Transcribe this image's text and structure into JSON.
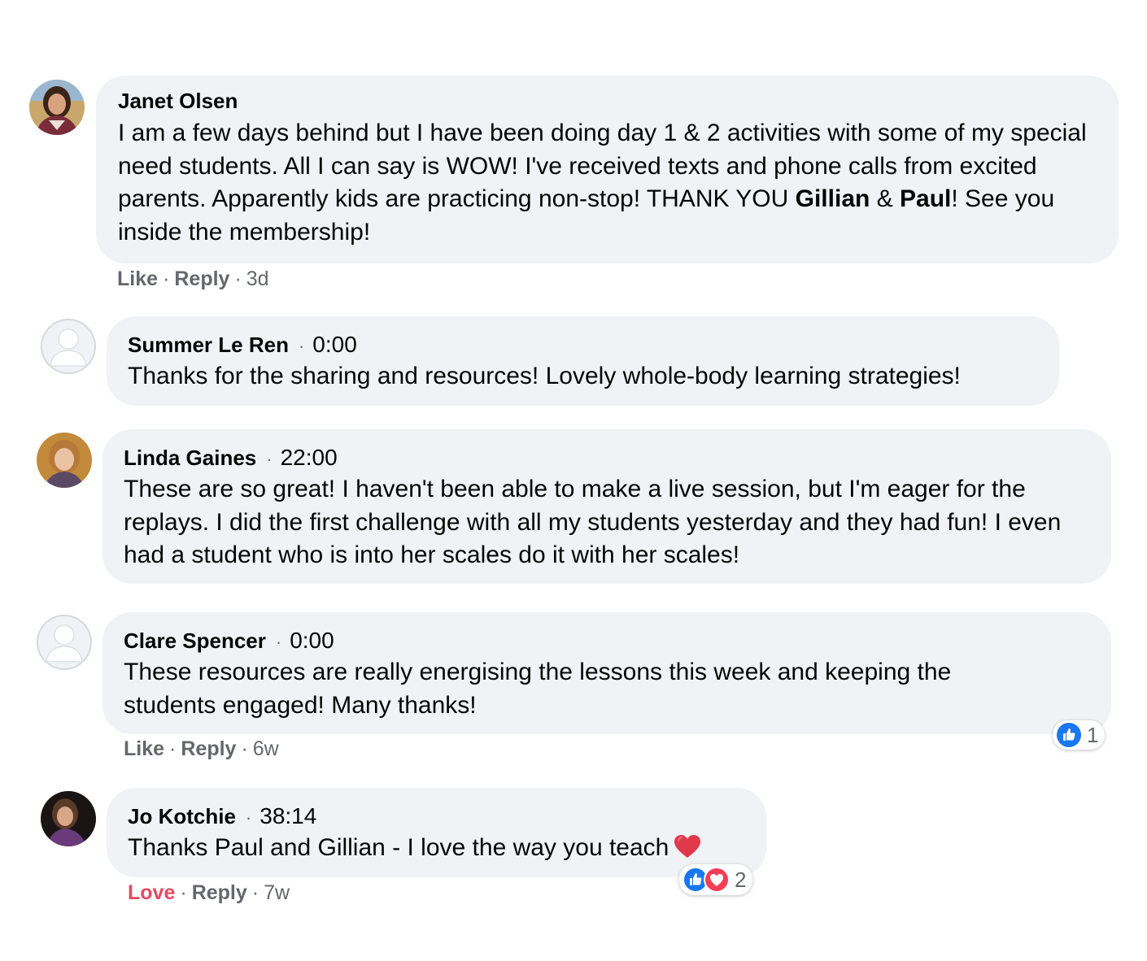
{
  "comments": [
    {
      "author": "Janet Olsen",
      "text_parts": [
        "I am a few days behind but I have been doing day 1 & 2 activities with some of my special need students. All I can say is WOW! I've received texts and phone calls from excited parents. Apparently kids are practicing non-stop! THANK YOU ",
        "Gillian",
        " & ",
        "Paul",
        "! See you inside the membership!"
      ],
      "actions": {
        "like": "Like",
        "reply": "Reply",
        "age": "3d"
      }
    },
    {
      "author": "Summer Le Ren",
      "timestamp": "0:00",
      "text": "Thanks for the sharing and resources! Lovely whole-body learning strategies!"
    },
    {
      "author": "Linda Gaines",
      "timestamp": "22:00",
      "text": "These are so great! I haven't been able to make a live session, but I'm eager for the replays. I did the first challenge with all my students yesterday and they had fun! I even had a student who is into her scales do it with her scales!"
    },
    {
      "author": "Clare Spencer",
      "timestamp": "0:00",
      "text": "These resources are really energising the lessons this week and keeping the students engaged! Many thanks!",
      "actions": {
        "like": "Like",
        "reply": "Reply",
        "age": "6w"
      },
      "reactions": {
        "icons": [
          "like-icon"
        ],
        "count": "1"
      }
    },
    {
      "author": "Jo Kotchie",
      "timestamp": "38:14",
      "text": "Thanks Paul and Gillian - I love the way you teach",
      "emoji": "red-heart-emoji",
      "actions": {
        "like": "Love",
        "reply": "Reply",
        "age": "7w"
      },
      "reactions": {
        "icons": [
          "like-icon",
          "love-icon"
        ],
        "count": "2"
      }
    }
  ],
  "colors": {
    "bubble": "#f0f2f5",
    "meta_text": "#65676b",
    "love_red": "#e4495f",
    "like_blue": "#1877f2"
  },
  "separator": "·"
}
